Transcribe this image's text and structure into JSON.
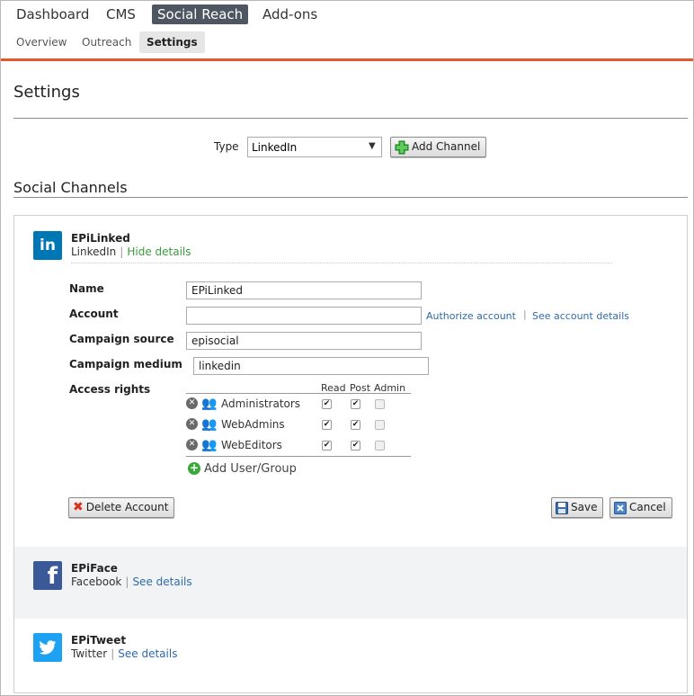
{
  "top_nav": [
    "Dashboard",
    "CMS",
    "Social Reach",
    "Add-ons"
  ],
  "sub_nav": [
    "Overview",
    "Outreach",
    "Settings"
  ],
  "page_title": "Settings",
  "type_label": "Type",
  "type_selected": "LinkedIn",
  "add_channel_label": "Add Channel",
  "section_title": "Social Channels",
  "channels": [
    {
      "name": "EPiLinked",
      "network": "LinkedIn",
      "link": "Hide details",
      "icon": "linkedin-icon"
    },
    {
      "name": "EPiFace",
      "network": "Facebook",
      "link": "See details",
      "icon": "facebook-icon"
    },
    {
      "name": "EPiTweet",
      "network": "Twitter",
      "link": "See details",
      "icon": "twitter-icon"
    }
  ],
  "form": {
    "name_label": "Name",
    "name_value": "EPiLinked",
    "account_label": "Account",
    "account_value": "",
    "authorize_link": "Authorize account",
    "see_account_link": "See account details",
    "source_label": "Campaign source",
    "source_value": "episocial",
    "medium_label": "Campaign medium",
    "medium_value": "linkedin",
    "access_label": "Access rights",
    "rights_headers": [
      "Read",
      "Post",
      "Admin"
    ],
    "groups": [
      {
        "name": "Administrators",
        "read": true,
        "post": true,
        "admin": false
      },
      {
        "name": "WebAdmins",
        "read": true,
        "post": true,
        "admin": false
      },
      {
        "name": "WebEditors",
        "read": true,
        "post": true,
        "admin": false
      }
    ],
    "add_group_label": "Add User/Group",
    "delete_label": "Delete Account",
    "save_label": "Save",
    "cancel_label": "Cancel"
  },
  "colors": {
    "accent": "#e8572c",
    "nav_active": "#4e5662",
    "link": "#2f6aa8",
    "green_link": "#3a9a3a",
    "linkedin": "#0077b5",
    "facebook": "#3b5998",
    "twitter": "#1da1f2"
  }
}
